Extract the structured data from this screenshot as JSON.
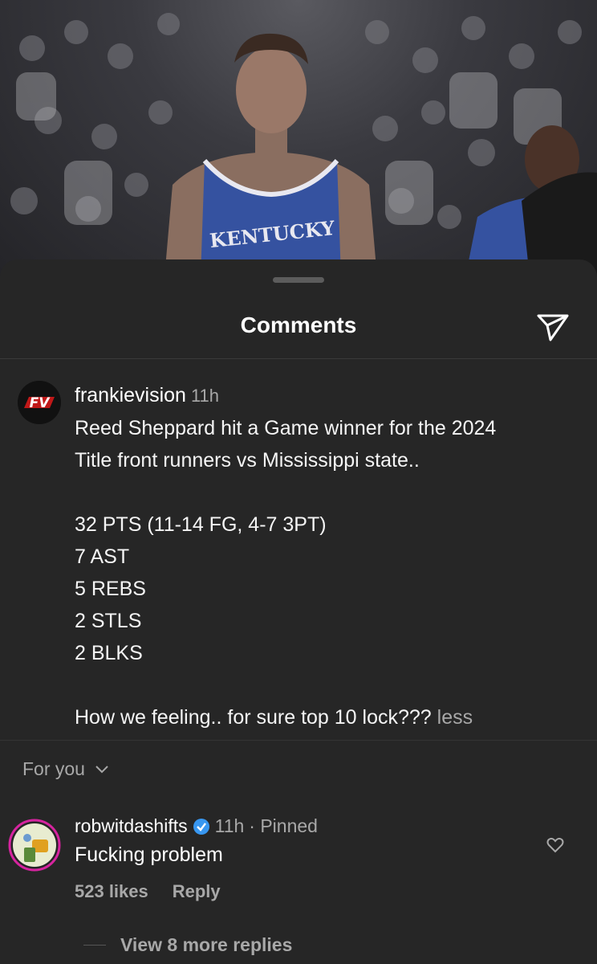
{
  "header": {
    "title": "Comments",
    "share_icon": "send-icon"
  },
  "post_image": {
    "jersey_text": "KENTUCKY"
  },
  "caption": {
    "avatar_logo": "FV",
    "username": "frankievision",
    "time": "11h",
    "lines": [
      "Reed Sheppard hit a Game winner for the 2024",
      "Title front runners vs Mississippi state..",
      "",
      "32 PTS (11-14 FG, 4-7 3PT)",
      "7 AST",
      "5 REBS",
      "2 STLS",
      "2 BLKS",
      "",
      "How we feeling.. for sure top 10 lock???"
    ],
    "less_label": "less"
  },
  "filter": {
    "label": "For you"
  },
  "comment": {
    "username": "robwitdashifts",
    "verified": true,
    "time": "11h",
    "pinned": "· Pinned",
    "text": "Fucking problem",
    "likes": "523 likes",
    "reply_label": "Reply",
    "view_replies": "View 8 more replies"
  },
  "colors": {
    "background": "#262626",
    "secondary_text": "#a8a8a8",
    "verified": "#3897f0"
  }
}
